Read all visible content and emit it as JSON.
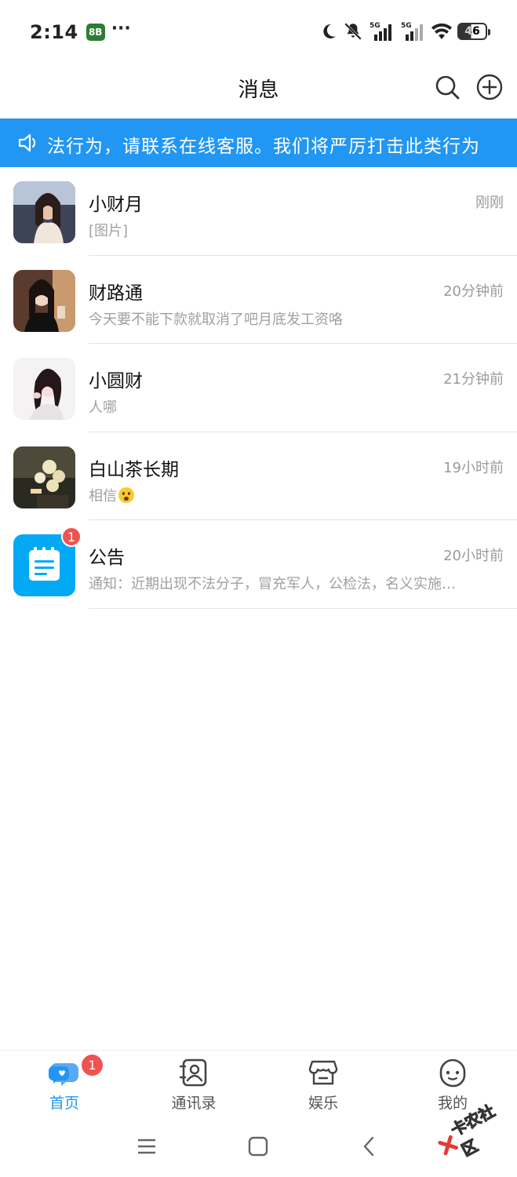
{
  "status_bar": {
    "time": "2:14",
    "app_icon_text": "8B",
    "more": "···",
    "network_1": "5G",
    "network_2": "5G",
    "battery": "46"
  },
  "header": {
    "title": "消息"
  },
  "notice": {
    "text": "法行为，请联系在线客服。我们将严厉打击此类行为"
  },
  "conversations": [
    {
      "name": "小财月",
      "time": "刚刚",
      "message": "[图片]",
      "avatar": "photo-woman-seaside"
    },
    {
      "name": "财路通",
      "time": "20分钟前",
      "message": "今天要不能下款就取消了吧月底发工资咯",
      "avatar": "photo-woman-cafe"
    },
    {
      "name": "小圆财",
      "time": "21分钟前",
      "message": "人哪",
      "avatar": "photo-woman-white"
    },
    {
      "name": "白山茶长期",
      "time": "19小时前",
      "message": "相信",
      "emoji": "frowning-emoji",
      "avatar": "photo-flowers"
    },
    {
      "name": "公告",
      "time": "20小时前",
      "message": "通知：近期出现不法分子，冒充军人，公检法，名义实施…",
      "avatar": "notice-icon",
      "badge": "1"
    }
  ],
  "bottom_nav": {
    "items": [
      {
        "label": "首页",
        "icon": "chat-bubble-icon",
        "active": true,
        "badge": "1"
      },
      {
        "label": "通讯录",
        "icon": "contacts-icon"
      },
      {
        "label": "娱乐",
        "icon": "store-icon"
      },
      {
        "label": "我的",
        "icon": "profile-face-icon"
      }
    ]
  },
  "watermark": "卡农社区",
  "colors": {
    "accent": "#2196f3",
    "badge": "#ef5350",
    "notice_bg": "#2196f3"
  }
}
